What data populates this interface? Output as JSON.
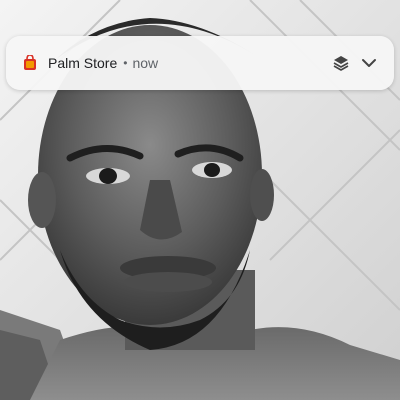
{
  "notification": {
    "app_name": "Palm Store",
    "separator": "•",
    "time": "now",
    "app_icon": "palm-store-icon",
    "actions": {
      "bundle_icon": "layers-icon",
      "expand_icon": "chevron-down-icon"
    }
  },
  "colors": {
    "notification_bg": "#f6f6f6",
    "primary_text": "#202124",
    "secondary_text": "#5f6368",
    "icon_color": "#444444",
    "app_icon_red": "#d93025",
    "app_icon_orange": "#f29900"
  }
}
